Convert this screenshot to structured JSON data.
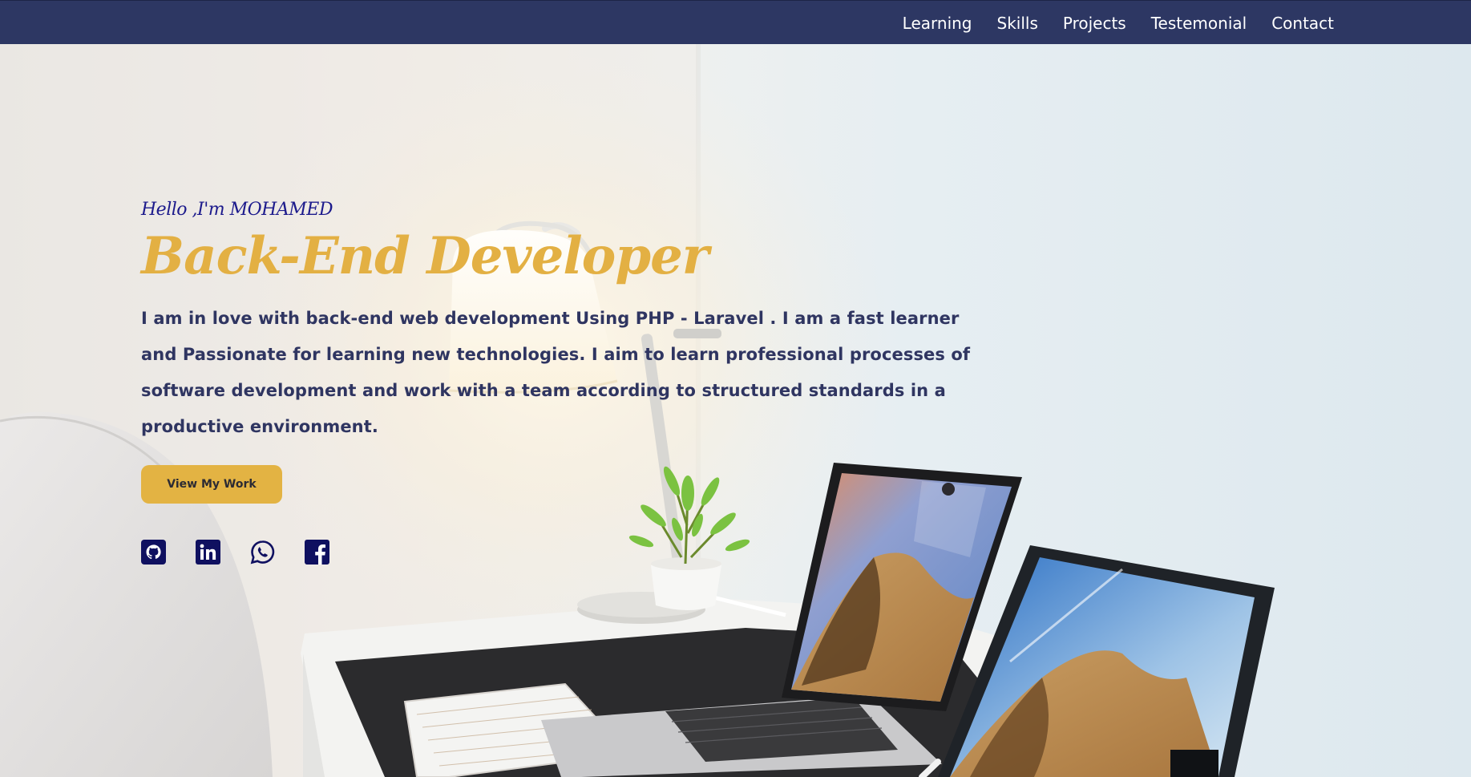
{
  "nav": {
    "items": [
      {
        "label": "Learning"
      },
      {
        "label": "Skills"
      },
      {
        "label": "Projects"
      },
      {
        "label": "Testemonial"
      },
      {
        "label": "Contact"
      }
    ]
  },
  "hero": {
    "greeting": "Hello ,I'm MOHAMED",
    "role": "Back-End Developer",
    "bio": "I am in love with back-end web development Using PHP - Laravel . I am a fast learner and Passionate for learning new technologies. I aim to learn professional processes of software development and work with a team according to structured standards in a productive environment.",
    "cta_label": "View My Work",
    "socials": [
      {
        "icon": "github-icon"
      },
      {
        "icon": "linkedin-icon"
      },
      {
        "icon": "whatsapp-icon"
      },
      {
        "icon": "facebook-icon"
      }
    ]
  },
  "colors": {
    "navbar": "#2d3763",
    "accent": "#e3b343",
    "greeting": "#1c1a8c",
    "bio_text": "#2f3561",
    "icon": "#0f1060"
  }
}
